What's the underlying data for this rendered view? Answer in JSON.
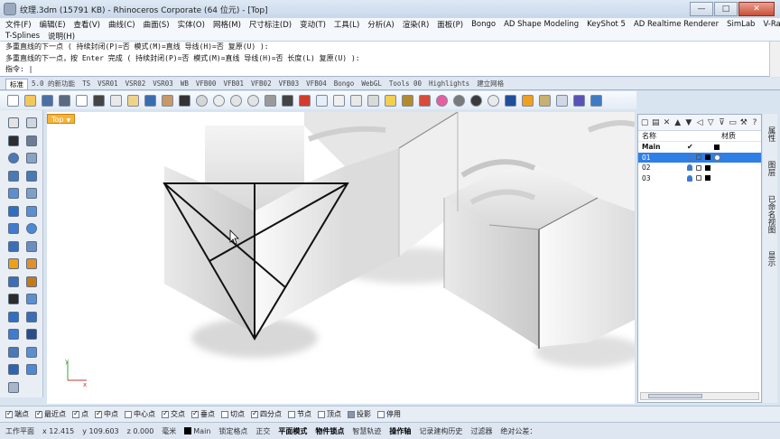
{
  "window": {
    "title": "纹理.3dm (15791 KB) - Rhinoceros Corporate (64 位元) - [Top]",
    "btn_min": "—",
    "btn_max": "□",
    "btn_close": "✕"
  },
  "menu": {
    "row1": [
      "文件(F)",
      "编辑(E)",
      "查看(V)",
      "曲线(C)",
      "曲面(S)",
      "实体(O)",
      "网格(M)",
      "尺寸标注(D)",
      "变动(T)",
      "工具(L)",
      "分析(A)",
      "渲染(R)",
      "面板(P)",
      "Bongo",
      "AD Shape Modeling",
      "KeyShot 5",
      "AD Realtime Renderer",
      "SimLab",
      "V-Ray"
    ],
    "row2": [
      "T-Splines",
      "说明(H)"
    ]
  },
  "command": {
    "line1": "多重直线的下一点 ( 持续封闭(P)=否  模式(M)=直线  导线(H)=否  复原(U) ):",
    "line2": "多重直线的下一点，按 Enter 完成 ( 持续封闭(P)=否  模式(M)=直线  导线(H)=否  长度(L)  复原(U) ):",
    "prompt": "指令: |"
  },
  "tabs": [
    "标准",
    "5.0 的新功能",
    "TS",
    "VSR01",
    "VSR02",
    "VSR03",
    "WB",
    "VFB00",
    "VFB01",
    "VFB02",
    "VFB03",
    "VFB04",
    "Bongo",
    "WebGL",
    "Tools 00",
    "Highlights",
    "建立网格"
  ],
  "active_tab": 0,
  "toolbar_icons": [
    "new-file-icon",
    "open-file-icon",
    "save-icon",
    "print-icon",
    "import-icon",
    "cut-icon",
    "copy-icon",
    "paste-icon",
    "undo-icon",
    "pan-hand-icon",
    "move-icon",
    "zoom-icon",
    "zoom-window-icon",
    "zoom-extents-icon",
    "zoom-selected-icon",
    "rotate-view-icon",
    "four-view-icon",
    "car-icon",
    "named-view-icon",
    "cplane-icon",
    "snap-icon",
    "layer-icon",
    "light-icon",
    "lock-icon",
    "material-icon",
    "color-wheel-icon",
    "render-sphere-icon",
    "render-preview-icon",
    "env-sphere-icon",
    "render-icon",
    "select-icon",
    "settings-gear-icon",
    "options-icon",
    "help-icon",
    "python-icon"
  ],
  "toolbar_colors": [
    "#ffffff",
    "#f3c85b",
    "#4a6fa5",
    "#5b6b80",
    "#ffffff",
    "#444444",
    "#e9e9e9",
    "#efd38a",
    "#3a6db0",
    "#c89866",
    "#333333",
    "#d6d6d6",
    "#ececec",
    "#e3e3e3",
    "#e3e3e3",
    "#9a9a9a",
    "#444444",
    "#d33c2b",
    "#e6eef8",
    "#f0f0f0",
    "#e8e8e8",
    "#d9d9d9",
    "#f0cf52",
    "#b38b2e",
    "#d94c3a",
    "#e85da0",
    "#7a7a7a",
    "#3a3a3a",
    "#eaeaea",
    "#1f4f9a",
    "#f0a020",
    "#c8b070",
    "#d1d8e4",
    "#5a52b7",
    "#3f7bc2"
  ],
  "left_tools": [
    "select-arrow-icon",
    "point-icon",
    "polyline-icon",
    "curve-icon",
    "circle-icon",
    "arc-icon",
    "ellipse-icon",
    "rectangle-icon",
    "polygon-icon",
    "fillet-curve-icon",
    "surface-icon",
    "patch-icon",
    "box-icon",
    "sphere-icon",
    "cylinder-icon",
    "mesh-icon",
    "boolean-icon",
    "explode-icon",
    "gumball-icon",
    "trim-icon",
    "extrude-icon",
    "loft-icon",
    "text-icon",
    "dimension-icon",
    "array-icon",
    "transform-icon",
    "group-icon",
    "block-icon",
    "render-mesh-icon",
    "chart-icon",
    "more-tools-icon"
  ],
  "viewport": {
    "label": "Top",
    "arrow": "▼"
  },
  "layers": {
    "col_name": "名称",
    "col_material": "材质",
    "rows": [
      {
        "name": "Main",
        "check": "✔",
        "current": true
      },
      {
        "name": "01",
        "selected": true
      },
      {
        "name": "02"
      },
      {
        "name": "03"
      }
    ]
  },
  "side_tabs": [
    "属性",
    "图层",
    "已命名视图",
    "显示"
  ],
  "osnap": [
    {
      "label": "端点",
      "on": true
    },
    {
      "label": "最近点",
      "on": true
    },
    {
      "label": "点",
      "on": true
    },
    {
      "label": "中点",
      "on": true
    },
    {
      "label": "中心点",
      "on": false
    },
    {
      "label": "交点",
      "on": true
    },
    {
      "label": "垂点",
      "on": true
    },
    {
      "label": "切点",
      "on": false
    },
    {
      "label": "四分点",
      "on": true
    },
    {
      "label": "节点",
      "on": false
    },
    {
      "label": "顶点",
      "on": false
    },
    {
      "label": "投影",
      "on": false,
      "filled": true
    },
    {
      "label": "停用",
      "on": false
    }
  ],
  "status": {
    "cplane": "工作平面",
    "x": "x 12.415",
    "y": "y 109.603",
    "z": "z 0.000",
    "units": "毫米",
    "layer": "Main",
    "items": [
      "锁定格点",
      "正交",
      "平面模式",
      "物件锁点",
      "智慧轨迹",
      "操作轴",
      "记录建构历史",
      "过滤器",
      "绝对公差："
    ],
    "bold": [
      "平面模式",
      "物件锁点",
      "操作轴"
    ]
  },
  "colors": {
    "accent": "#2f7fe6",
    "viewport_label": "#f4b43c",
    "close_button": "#c9503a"
  }
}
